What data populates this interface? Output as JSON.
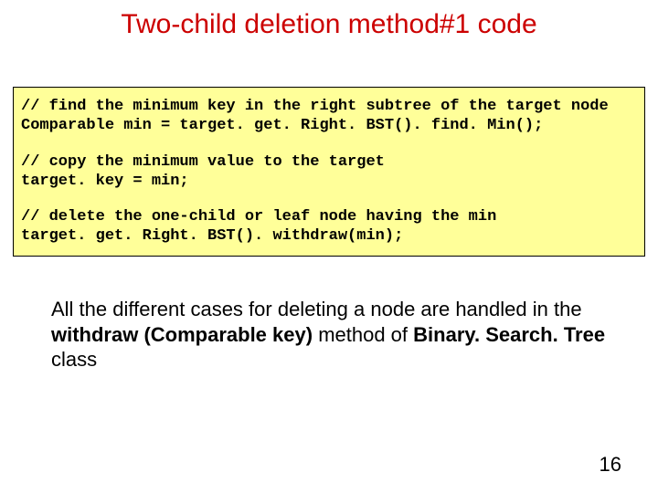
{
  "title": "Two-child deletion method#1 code",
  "code": {
    "l1": "// find the minimum key in the right subtree of the target node",
    "l2": "Comparable min = target. get. Right. BST(). find. Min();",
    "l3": "// copy the minimum value to the target",
    "l4": "target. key = min;",
    "l5": "// delete the one-child or leaf node having the min",
    "l6": "target. get. Right. BST(). withdraw(min);"
  },
  "body": {
    "pre": "All the different cases for deleting a node  are handled in the ",
    "bold1": "withdraw (Comparable key)",
    "mid": " method of ",
    "bold2": "Binary. Search. Tree",
    "post": " class"
  },
  "page_number": "16"
}
